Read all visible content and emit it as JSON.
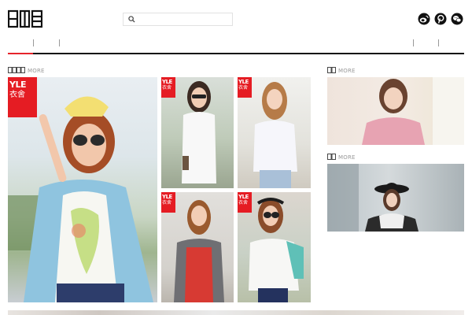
{
  "header": {
    "logo_text": "",
    "search": {
      "placeholder": "",
      "value": ""
    },
    "social": [
      {
        "name": "weibo-icon"
      },
      {
        "name": "pinterest-icon"
      },
      {
        "name": "wechat-icon"
      }
    ]
  },
  "nav": {
    "items": [
      "",
      "",
      ""
    ],
    "right_items": [
      "",
      ""
    ]
  },
  "sections": {
    "main": {
      "title": "",
      "more": "MORE"
    },
    "side_top": {
      "title": "",
      "more": "MORE"
    },
    "side_bottom": {
      "title": "",
      "more": "MORE"
    }
  },
  "badges": {
    "line1": "YLE",
    "line2": "衣舍"
  },
  "colors": {
    "accent": "#e5242b",
    "badge": "#e51c23",
    "nav_line": "#111111"
  }
}
